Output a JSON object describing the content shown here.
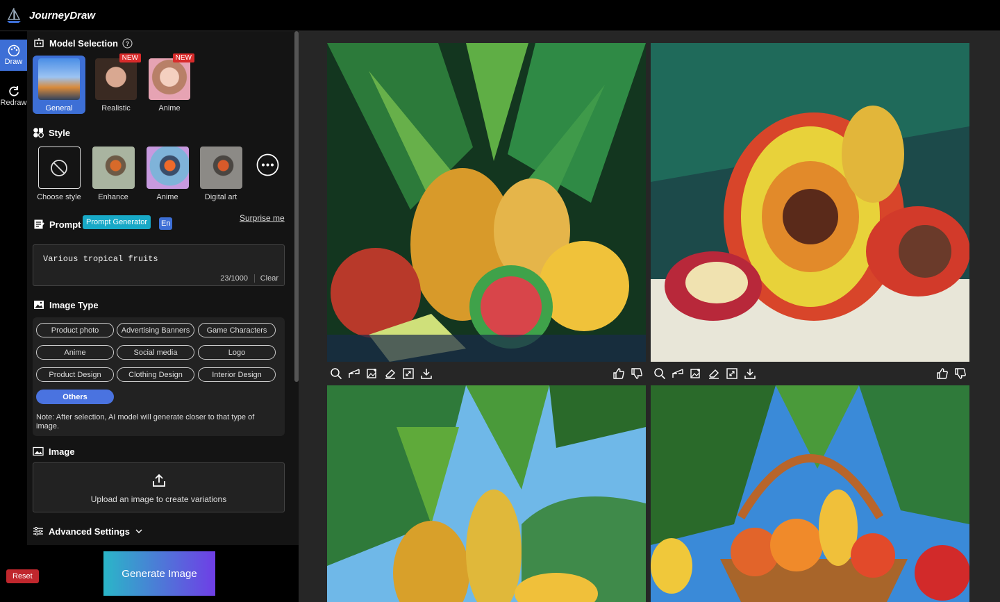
{
  "app": {
    "title": "JourneyDraw"
  },
  "rail": {
    "draw": "Draw",
    "redraw": "Redraw"
  },
  "model_section": {
    "title": "Model Selection",
    "models": [
      {
        "label": "General",
        "badge": ""
      },
      {
        "label": "Realistic",
        "badge": "NEW"
      },
      {
        "label": "Anime",
        "badge": "NEW"
      }
    ]
  },
  "style_section": {
    "title": "Style",
    "items": [
      {
        "label": "Choose style"
      },
      {
        "label": "Enhance"
      },
      {
        "label": "Anime"
      },
      {
        "label": "Digital art"
      }
    ]
  },
  "prompt": {
    "title": "Prompt",
    "generator_label": "Prompt Generator",
    "lang": "En",
    "surprise": "Surprise me",
    "value": "Various tropical fruits",
    "count": "23/1000",
    "clear": "Clear"
  },
  "image_type": {
    "title": "Image Type",
    "options": [
      "Product photo",
      "Advertising Banners",
      "Game Characters",
      "Anime",
      "Social media",
      "Logo",
      "Product Design",
      "Clothing Design",
      "Interior Design",
      "Others"
    ],
    "selected": "Others",
    "note": "Note: After selection, AI model will generate closer to that type of image."
  },
  "image_section": {
    "title": "Image",
    "upload_text": "Upload an image to create variations"
  },
  "advanced": {
    "title": "Advanced Settings"
  },
  "actions": {
    "reset": "Reset",
    "generate": "Generate Image"
  },
  "colors": {
    "accent": "#3d6fd6",
    "generate_start": "#2ab6c8",
    "generate_end": "#6f3ee6",
    "reset": "#c0272d",
    "new_badge": "#d92b2b"
  }
}
